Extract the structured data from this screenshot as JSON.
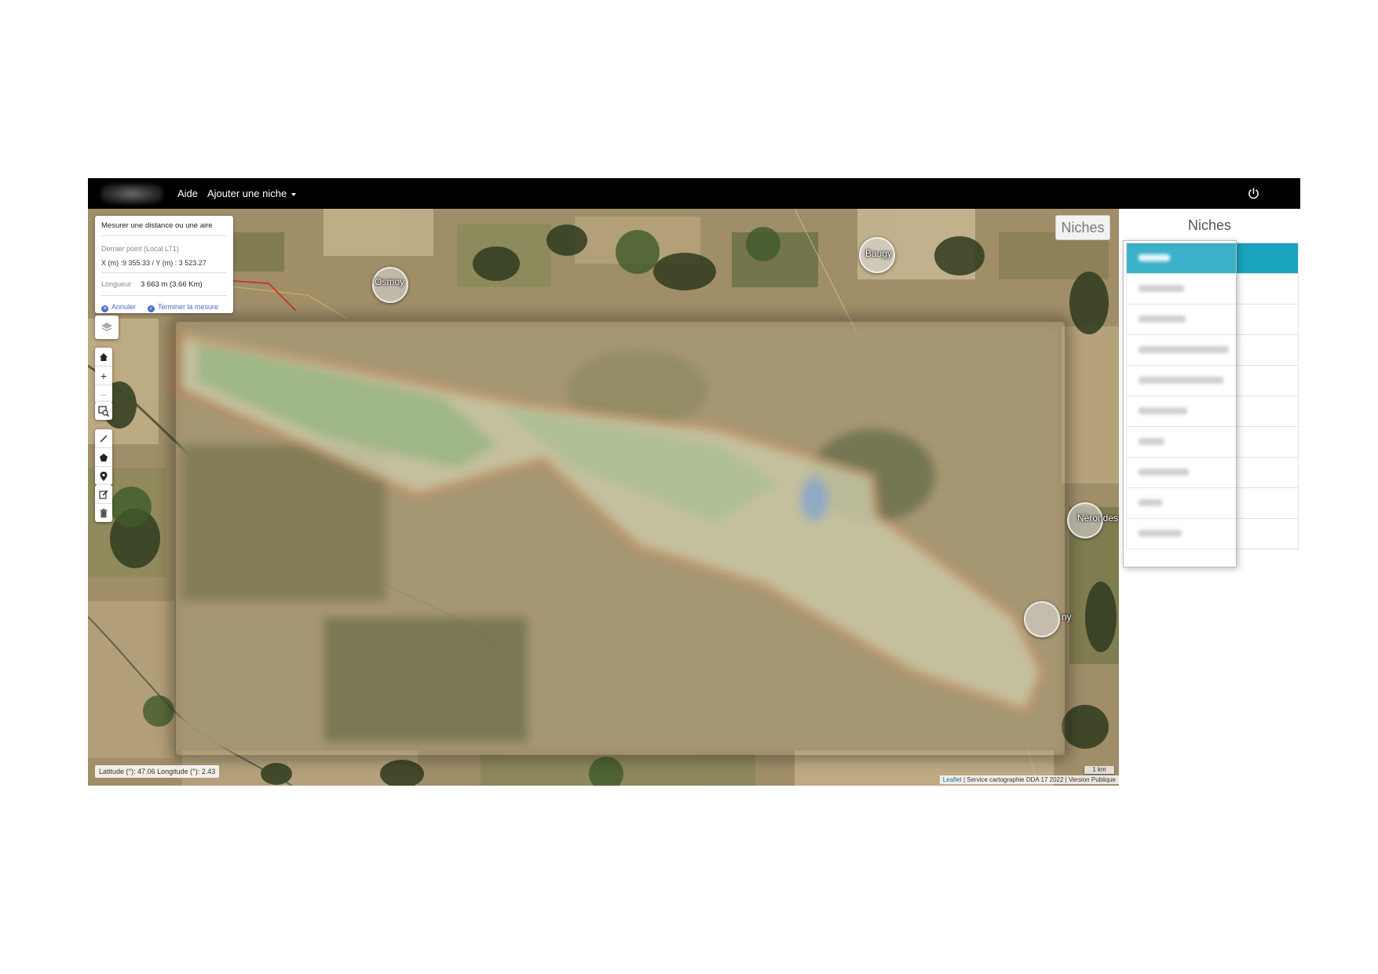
{
  "navbar": {
    "brand": "",
    "links": {
      "aide": "Aide",
      "ajouter_niche": "Ajouter une niche"
    },
    "power_icon": "power-icon"
  },
  "measure": {
    "title": "Mesurer une distance ou une aire",
    "last_point_label": "Dernier point (Local LT1)",
    "xy_value": "X (m) :9 355.33 / Y (m) : 3 523.27",
    "length_label": "Longueur",
    "length_value": "3 663 m (3.66 Km)",
    "cancel_label": "Annuler",
    "finish_label": "Terminer la mesure"
  },
  "map_controls": {
    "layers_icon": "layers-icon",
    "home_icon": "home-icon",
    "zoom_in": "+",
    "zoom_out": "−",
    "zoom_box_icon": "zoom-box-icon",
    "draw_line_icon": "line-icon",
    "draw_polygon_icon": "polygon-icon",
    "marker_icon": "marker-icon",
    "edit_icon": "edit-icon",
    "delete_icon": "trash-icon"
  },
  "map": {
    "niches_toggle": "Niches",
    "cities": [
      "Osmoy",
      "Baugy",
      "Nérondes",
      "ny"
    ],
    "coords": "Latitude (°): 47.06 Longitude (°): 2.43",
    "scale": "1 km",
    "attribution_link": "Leaflet",
    "attribution_text": " | Service cartographie DDA 17 2022 | Version Publique",
    "colors": {
      "boundary": "#d2622a",
      "active": "#1aa3bf"
    }
  },
  "sidebar": {
    "title": "Niches",
    "items_count_visible": 10
  }
}
